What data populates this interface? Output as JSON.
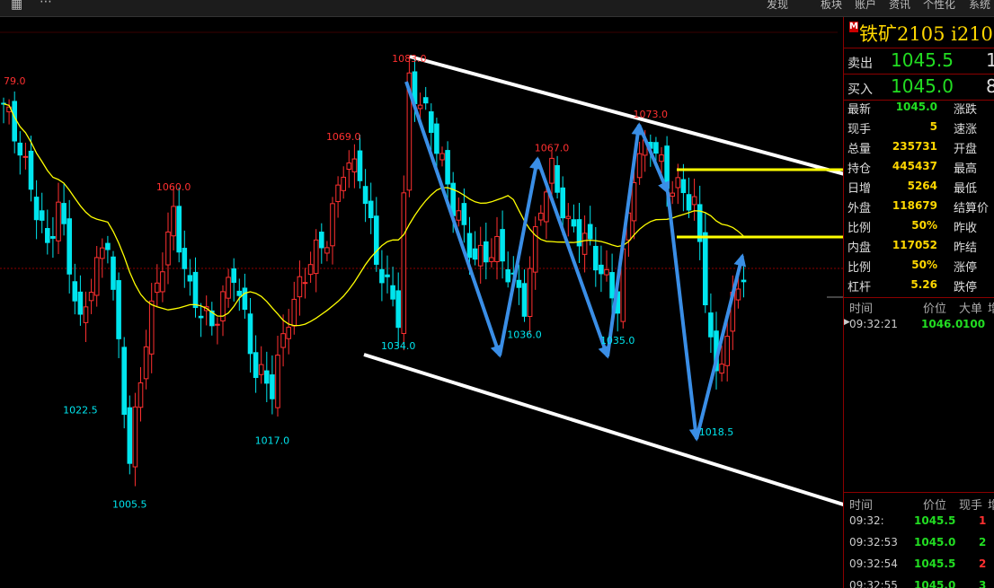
{
  "toolbar": {
    "menu": [
      "发现",
      "板块",
      "账户",
      "资讯",
      "个性化",
      "系统"
    ]
  },
  "chart": {
    "high_labels": [
      {
        "text": "79.0",
        "price": 1079.0,
        "bar": 0
      },
      {
        "text": "1060.0",
        "price": 1060.0,
        "bar": 31
      },
      {
        "text": "1069.0",
        "price": 1069.0,
        "bar": 62
      },
      {
        "text": "1083.0",
        "price": 1083.0,
        "bar": 74
      },
      {
        "text": "1067.0",
        "price": 1067.0,
        "bar": 100
      },
      {
        "text": "1073.0",
        "price": 1073.0,
        "bar": 118
      }
    ],
    "low_labels": [
      {
        "text": "1022.5",
        "price": 1022.5,
        "bar": 14
      },
      {
        "text": "1005.5",
        "price": 1005.5,
        "bar": 23
      },
      {
        "text": "1017.0",
        "price": 1017.0,
        "bar": 49
      },
      {
        "text": "1034.0",
        "price": 1034.0,
        "bar": 72
      },
      {
        "text": "1036.0",
        "price": 1036.0,
        "bar": 95
      },
      {
        "text": "1035.0",
        "price": 1035.0,
        "bar": 112
      },
      {
        "text": "1018.5",
        "price": 1018.5,
        "bar": 130
      }
    ],
    "colors": {
      "up": "#ff3030",
      "down": "#00e5ee",
      "ma": "#ffff00",
      "arrow": "#3a8ee6"
    }
  },
  "panel": {
    "title": "铁矿2105  i210",
    "sell_label": "卖出",
    "sell_price": "1045.5",
    "sell_vol": "1",
    "buy_label": "买入",
    "buy_price": "1045.0",
    "buy_vol": "8",
    "quote_rows": [
      {
        "label": "最新",
        "value": "1045.0",
        "color": "#22dd22",
        "right": "涨跌"
      },
      {
        "label": "现手",
        "value": "5",
        "color": "#ffd700",
        "right": "速涨"
      },
      {
        "label": "总量",
        "value": "235731",
        "color": "#ffd700",
        "right": "开盘"
      },
      {
        "label": "持仓",
        "value": "445437",
        "color": "#ffd700",
        "right": "最高"
      },
      {
        "label": "日增",
        "value": "5264",
        "color": "#ffd700",
        "right": "最低"
      },
      {
        "label": "外盘",
        "value": "118679",
        "color": "#ffd700",
        "right": "结算价"
      },
      {
        "label": "比例",
        "value": "50%",
        "color": "#ffd700",
        "right": "昨收"
      },
      {
        "label": "内盘",
        "value": "117052",
        "color": "#ffd700",
        "right": "昨结"
      },
      {
        "label": "比例",
        "value": "50%",
        "color": "#ffd700",
        "right": "涨停"
      },
      {
        "label": "杠杆",
        "value": "5.26",
        "color": "#ffd700",
        "right": "跌停"
      }
    ],
    "big_header": {
      "time": "时间",
      "price": "价位",
      "big": "大单",
      "extra": "增"
    },
    "big_rows": [
      {
        "time": "09:32:21",
        "price": "1046.0",
        "vol": "100"
      }
    ],
    "tick_header": {
      "time": "时间",
      "price": "价位",
      "vol": "现手",
      "extra": "增"
    },
    "tick_rows": [
      {
        "time": "09:32:",
        "price": "1045.5",
        "vol": "1",
        "vcolor": "#ff3030"
      },
      {
        "time": "09:32:53",
        "price": "1045.0",
        "vol": "2",
        "vcolor": "#22dd22"
      },
      {
        "time": "09:32:54",
        "price": "1045.5",
        "vol": "2",
        "vcolor": "#ff3030"
      },
      {
        "time": "09:32:55",
        "price": "1045.0",
        "vol": "3",
        "vcolor": "#22dd22"
      }
    ]
  }
}
